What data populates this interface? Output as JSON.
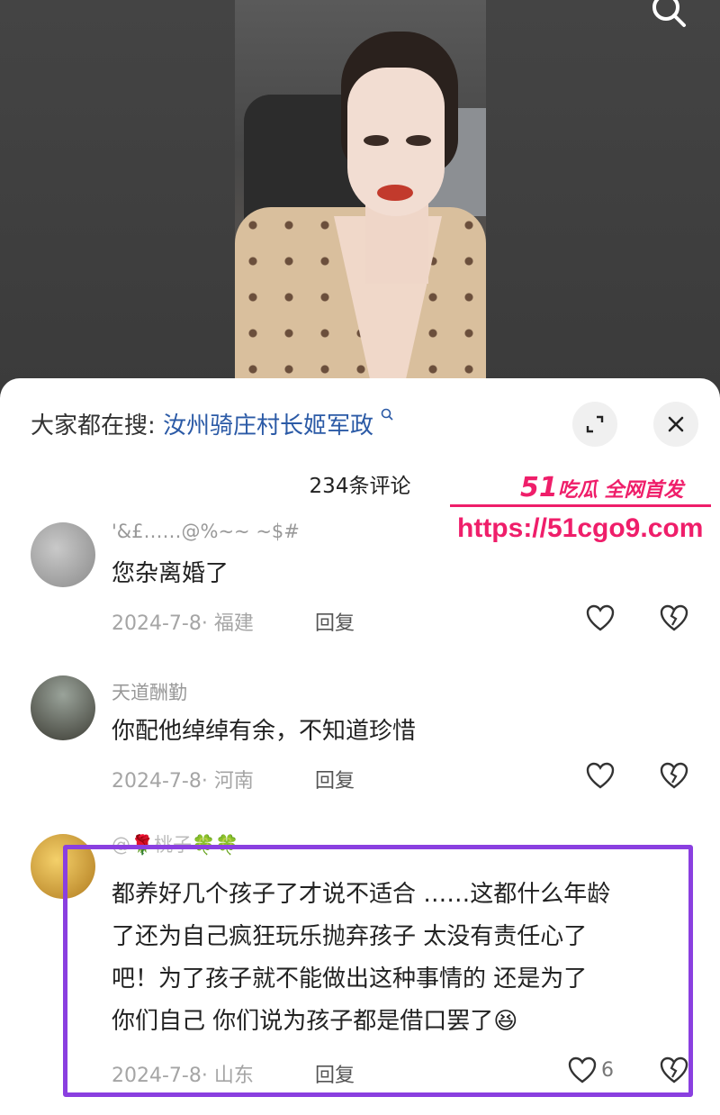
{
  "search_bar": {
    "prefix": "大家都在搜:",
    "query": "汝州骑庄村长姬军政"
  },
  "comment_count": "234条评论",
  "watermark": {
    "brand_number": "51",
    "brand_text": "吃瓜 全网首发",
    "url": "https://51cgo9.com"
  },
  "comments": [
    {
      "username": "'&£……@%~~ ~$#",
      "text": "您杂离婚了",
      "date_location": "2024-7-8· 福建",
      "reply_label": "回复"
    },
    {
      "username": "天道酬勤",
      "text": "你配他绰绰有余，不知道珍惜",
      "date_location": "2024-7-8· 河南",
      "reply_label": "回复"
    },
    {
      "username": "@🌹桃子🍀🍀",
      "text_lines": [
        "都养好几个孩子了才说不适合 ……这都什么年龄",
        "了还为自己疯狂玩乐抛弃孩子 太没有责任心了",
        "吧！为了孩子就不能做出这种事情的 还是为了",
        "你们自己  你们说为孩子都是借口罢了😆"
      ],
      "date_location": "2024-7-8· 山东",
      "reply_label": "回复",
      "like_count": "6"
    }
  ],
  "colors": {
    "link": "#2b5aa6",
    "watermark": "#ef1e6a",
    "highlight": "#8a3fe0"
  }
}
